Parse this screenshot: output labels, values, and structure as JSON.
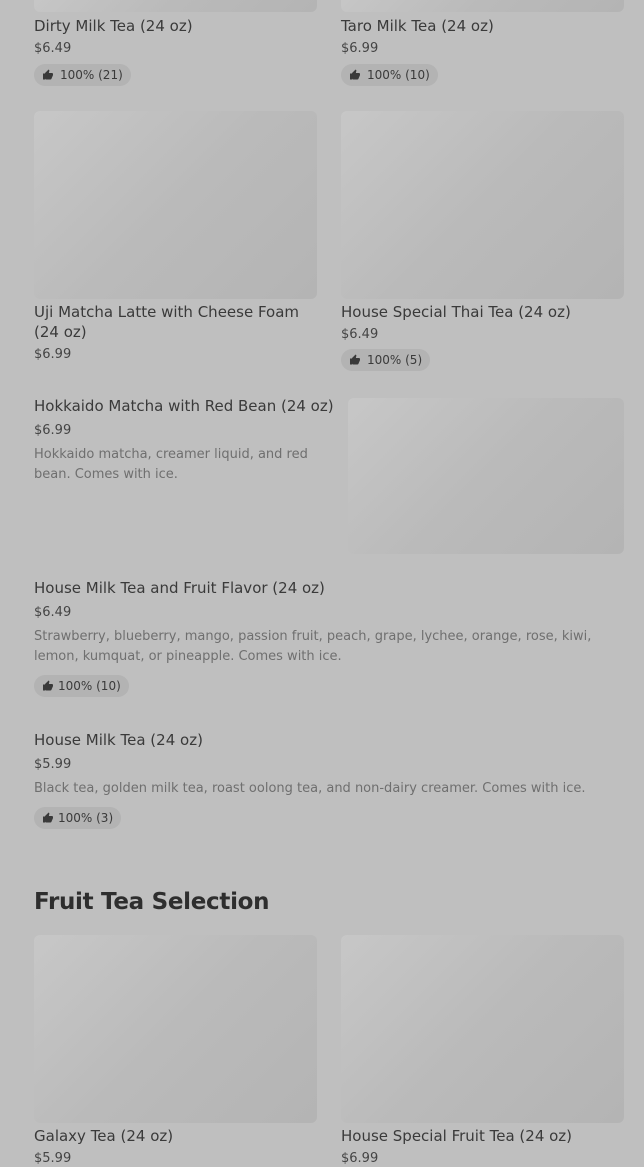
{
  "items": {
    "dirty_milk_tea": {
      "name": "Dirty Milk Tea (24 oz)",
      "price": "$6.49",
      "rating": "100% (21)"
    },
    "taro_milk_tea": {
      "name": "Taro Milk Tea (24 oz)",
      "price": "$6.99",
      "rating": "100% (10)"
    },
    "uji_matcha": {
      "name": "Uji Matcha Latte with Cheese Foam (24 oz)",
      "price": "$6.99"
    },
    "thai_tea": {
      "name": "House Special Thai Tea (24 oz)",
      "price": "$6.49",
      "rating": "100% (5)"
    },
    "hokkaido": {
      "name": "Hokkaido Matcha with Red Bean (24 oz)",
      "price": "$6.99",
      "description": "Hokkaido matcha, creamer liquid, and red bean. Comes with ice."
    },
    "milk_tea_fruit": {
      "name": "House Milk Tea and Fruit Flavor (24 oz)",
      "price": "$6.49",
      "description": "Strawberry, blueberry, mango, passion fruit, peach, grape, lychee, orange, rose, kiwi, lemon, kumquat, or pineapple. Comes with ice.",
      "rating": "100% (10)"
    },
    "house_milk_tea": {
      "name": "House Milk Tea (24 oz)",
      "price": "$5.99",
      "description": "Black tea, golden milk tea, roast oolong tea, and non-dairy creamer. Comes with ice.",
      "rating": "100% (3)"
    },
    "galaxy_tea": {
      "name": "Galaxy Tea (24 oz)",
      "price": "$5.99"
    },
    "fruit_tea": {
      "name": "House Special Fruit Tea (24 oz)",
      "price": "$6.99"
    }
  },
  "sections": {
    "fruit_tea": "Fruit Tea Selection"
  },
  "icons": {
    "rating": "thumbs-up-icon"
  },
  "colors": {
    "background": "#bfbfbf",
    "badge": "#b3b3b3",
    "text": "#333333"
  }
}
